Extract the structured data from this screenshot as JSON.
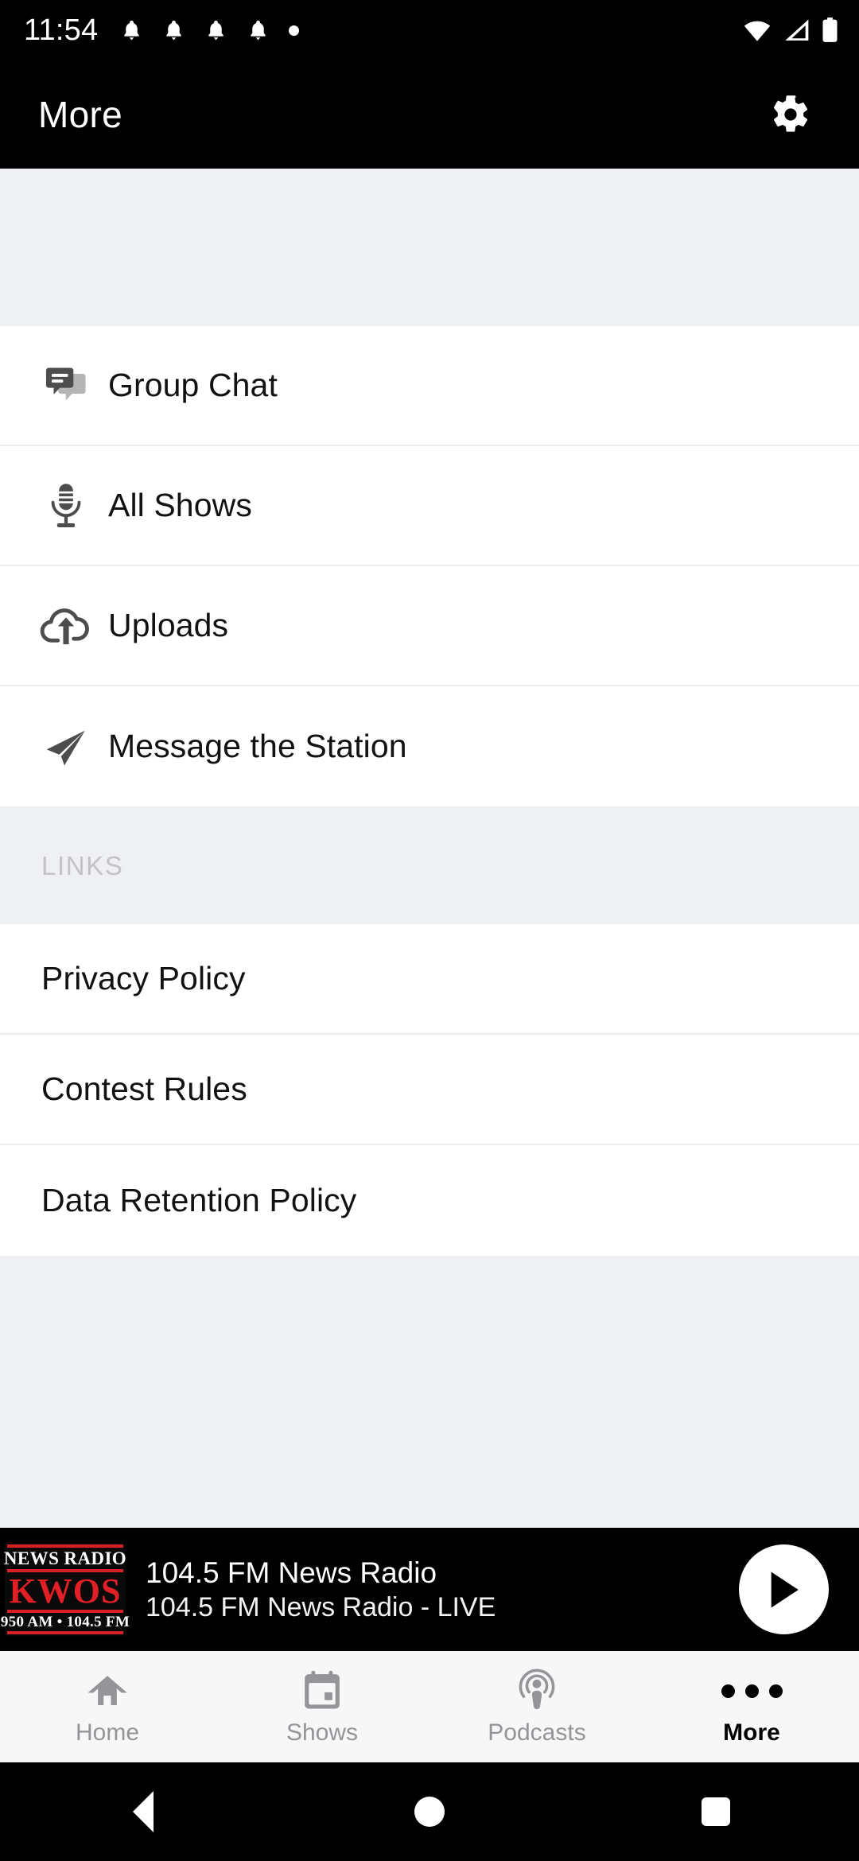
{
  "status_bar": {
    "time": "11:54",
    "notification_icons": [
      "bell-icon",
      "bell-icon",
      "bell-icon",
      "bell-icon",
      "dot-icon"
    ],
    "right_icons": [
      "wifi-icon",
      "cellular-signal-icon",
      "battery-icon"
    ]
  },
  "app_bar": {
    "title": "More",
    "settings_icon": "gear-icon"
  },
  "menu": {
    "items": [
      {
        "label": "Group Chat",
        "icon": "chat-bubbles-icon"
      },
      {
        "label": "All Shows",
        "icon": "microphone-icon"
      },
      {
        "label": "Uploads",
        "icon": "cloud-upload-icon"
      },
      {
        "label": "Message the Station",
        "icon": "paper-plane-icon"
      }
    ]
  },
  "links_section": {
    "header": "LINKS",
    "items": [
      {
        "label": "Privacy Policy"
      },
      {
        "label": "Contest Rules"
      },
      {
        "label": "Data Retention Policy"
      }
    ]
  },
  "player": {
    "station_logo": {
      "line1": "NEWS RADIO",
      "call_sign": "KWOS",
      "line3": "950 AM • 104.5 FM"
    },
    "title": "104.5 FM News Radio",
    "subtitle": "104.5 FM News Radio - LIVE",
    "play_button_icon": "play-icon"
  },
  "tab_bar": {
    "tabs": [
      {
        "label": "Home",
        "icon": "home-icon",
        "active": false
      },
      {
        "label": "Shows",
        "icon": "calendar-icon",
        "active": false
      },
      {
        "label": "Podcasts",
        "icon": "podcast-icon",
        "active": false
      },
      {
        "label": "More",
        "icon": "ellipsis-icon",
        "active": true
      }
    ]
  },
  "system_nav": {
    "buttons": [
      "back-icon",
      "home-icon",
      "recents-icon"
    ]
  },
  "colors": {
    "accent_red": "#d81f26",
    "bar_black": "#000000",
    "page_gray": "#eff0f4",
    "inactive_gray": "#949499"
  }
}
